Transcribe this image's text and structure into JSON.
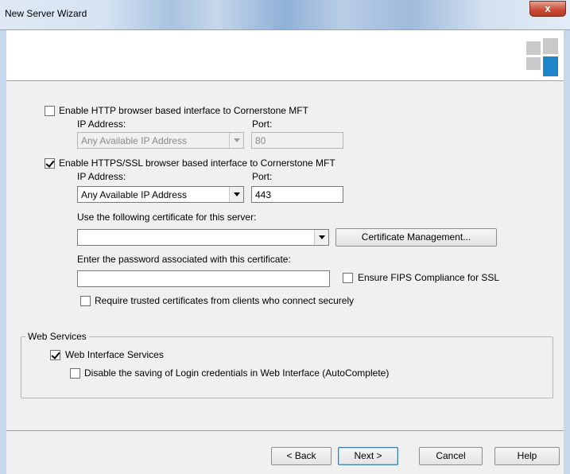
{
  "window": {
    "title": "New Server Wizard",
    "close_glyph": "x"
  },
  "http": {
    "enable_label": "Enable HTTP browser based interface to Cornerstone MFT",
    "enabled": false,
    "ip_label": "IP Address:",
    "ip_value": "Any Available IP Address",
    "port_label": "Port:",
    "port_value": "80"
  },
  "https": {
    "enable_label": "Enable HTTPS/SSL browser based interface to Cornerstone MFT",
    "enabled": true,
    "ip_label": "IP Address:",
    "ip_value": "Any Available IP Address",
    "port_label": "Port:",
    "port_value": "443",
    "cert_label": "Use the following certificate for this server:",
    "cert_value": "",
    "cert_mgmt_button": "Certificate Management...",
    "password_label": "Enter the password associated with this certificate:",
    "password_value": "",
    "fips_label": "Ensure FIPS Compliance for SSL",
    "fips_checked": false,
    "require_trusted_label": "Require trusted certificates from clients who connect securely",
    "require_trusted_checked": false
  },
  "web_services": {
    "group_title": "Web Services",
    "web_interface_label": "Web Interface Services",
    "web_interface_checked": true,
    "disable_saving_label": "Disable the saving of Login credentials in Web Interface (AutoComplete)",
    "disable_saving_checked": false
  },
  "footer": {
    "back": "< Back",
    "next": "Next >",
    "cancel": "Cancel",
    "help": "Help"
  },
  "colors": {
    "logo_light": "#c9c9c9",
    "logo_accent": "#1e86c9"
  }
}
